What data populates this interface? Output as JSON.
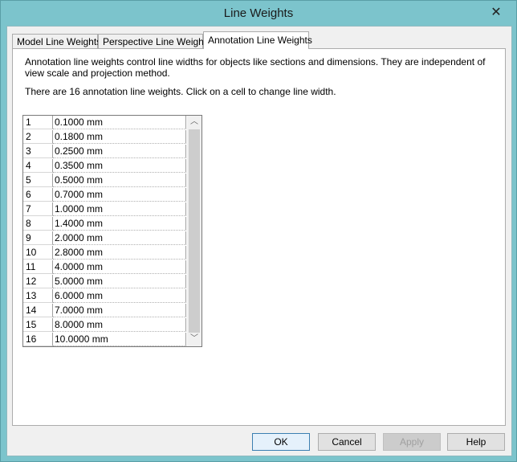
{
  "window": {
    "title": "Line Weights"
  },
  "tabs": [
    {
      "label": "Model Line Weights",
      "active": false
    },
    {
      "label": "Perspective Line Weights",
      "active": false
    },
    {
      "label": "Annotation Line Weights",
      "active": true
    }
  ],
  "panel": {
    "description": "Annotation line weights control line widths for objects like sections and dimensions. They are independent of view scale and projection method.",
    "count_text": "There are 16 annotation line weights. Click on a cell to change line width."
  },
  "grid": {
    "rows": [
      {
        "num": "1",
        "value": "0.1000 mm"
      },
      {
        "num": "2",
        "value": "0.1800 mm"
      },
      {
        "num": "3",
        "value": "0.2500 mm"
      },
      {
        "num": "4",
        "value": "0.3500 mm"
      },
      {
        "num": "5",
        "value": "0.5000 mm"
      },
      {
        "num": "6",
        "value": "0.7000 mm"
      },
      {
        "num": "7",
        "value": "1.0000 mm"
      },
      {
        "num": "8",
        "value": "1.4000 mm"
      },
      {
        "num": "9",
        "value": "2.0000 mm"
      },
      {
        "num": "10",
        "value": "2.8000 mm"
      },
      {
        "num": "11",
        "value": "4.0000 mm"
      },
      {
        "num": "12",
        "value": "5.0000 mm"
      },
      {
        "num": "13",
        "value": "6.0000 mm"
      },
      {
        "num": "14",
        "value": "7.0000 mm"
      },
      {
        "num": "15",
        "value": "8.0000 mm"
      },
      {
        "num": "16",
        "value": "10.0000 mm"
      }
    ]
  },
  "buttons": {
    "ok": "OK",
    "cancel": "Cancel",
    "apply": "Apply",
    "help": "Help"
  },
  "icons": {
    "close": "close-icon",
    "scroll_up": "chevron-up-icon",
    "scroll_down": "chevron-down-icon"
  }
}
